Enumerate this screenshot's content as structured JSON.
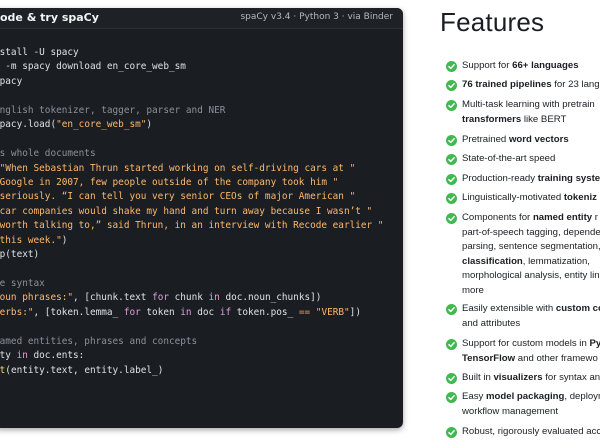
{
  "code": {
    "title": "ode & try spaCy",
    "meta": "spaCy v3.4 · Python 3 · via Binder",
    "lines": [
      [
        [
          "default",
          "nstall -U spacy"
        ]
      ],
      [
        [
          "default",
          "n -m spacy download en_core_web_sm"
        ]
      ],
      [
        [
          "default",
          "spacy"
        ]
      ],
      [
        [
          "default",
          ""
        ]
      ],
      [
        [
          "comment",
          "English tokenizer, tagger, parser and NER"
        ]
      ],
      [
        [
          "default",
          "spacy.load("
        ],
        [
          "string",
          "\"en_core_web_sm\""
        ],
        [
          "default",
          ")"
        ]
      ],
      [
        [
          "default",
          ""
        ]
      ],
      [
        [
          "comment",
          "ss whole documents"
        ]
      ],
      [
        [
          "default",
          "("
        ],
        [
          "string",
          "\"When Sebastian Thrun started working on self-driving cars at \""
        ]
      ],
      [
        [
          "string",
          "\"Google in 2007, few people outside of the company took him \""
        ]
      ],
      [
        [
          "string",
          "\"seriously. “I can tell you very senior CEOs of major American \""
        ]
      ],
      [
        [
          "string",
          "\"car companies would shake my hand and turn away because I wasn’t \""
        ]
      ],
      [
        [
          "string",
          "\"worth talking to,” said Thrun, in an interview with Recode earlier \""
        ]
      ],
      [
        [
          "string",
          "\"this week.\""
        ],
        [
          "default",
          ")"
        ]
      ],
      [
        [
          "default",
          "lp(text)"
        ]
      ],
      [
        [
          "default",
          ""
        ]
      ],
      [
        [
          "comment",
          "ze syntax"
        ]
      ],
      [
        [
          "string",
          "Noun phrases:\""
        ],
        [
          "default",
          ", [chunk.text "
        ],
        [
          "keyword",
          "for"
        ],
        [
          "default",
          " chunk "
        ],
        [
          "keyword",
          "in"
        ],
        [
          "default",
          " doc.noun_chunks])"
        ]
      ],
      [
        [
          "string",
          "Verbs:\""
        ],
        [
          "default",
          ", [token.lemma_ "
        ],
        [
          "keyword",
          "for"
        ],
        [
          "default",
          " token "
        ],
        [
          "keyword",
          "in"
        ],
        [
          "default",
          " doc "
        ],
        [
          "keyword",
          "if"
        ],
        [
          "default",
          " token.pos_ "
        ],
        [
          "op",
          "=="
        ],
        [
          "default",
          " "
        ],
        [
          "string",
          "\"VERB\""
        ],
        [
          "default",
          "])"
        ]
      ],
      [
        [
          "default",
          ""
        ]
      ],
      [
        [
          "comment",
          "named entities, phrases and concepts"
        ]
      ],
      [
        [
          "default",
          "ity "
        ],
        [
          "keyword",
          "in"
        ],
        [
          "default",
          " doc.ents:"
        ]
      ],
      [
        [
          "func",
          "nt"
        ],
        [
          "default",
          "(entity.text, entity.label_)"
        ]
      ]
    ]
  },
  "features": {
    "title": "Features",
    "items": [
      {
        "segments": [
          [
            "Support for "
          ],
          [
            "66+ languages",
            "b"
          ]
        ]
      },
      {
        "segments": [
          [
            "76 trained pipelines",
            "b"
          ],
          [
            " for 23 lang"
          ]
        ]
      },
      {
        "segments": [
          [
            "Multi-task learning with pretrain\n"
          ],
          [
            "transformers",
            "b"
          ],
          [
            " like BERT"
          ]
        ]
      },
      {
        "segments": [
          [
            "Pretrained "
          ],
          [
            "word vectors",
            "b"
          ]
        ]
      },
      {
        "segments": [
          [
            "State-of-the-art speed"
          ]
        ]
      },
      {
        "segments": [
          [
            "Production-ready "
          ],
          [
            "training syste",
            "b"
          ]
        ]
      },
      {
        "segments": [
          [
            "Linguistically-motivated "
          ],
          [
            "tokeniz",
            "b"
          ]
        ]
      },
      {
        "segments": [
          [
            "Components for "
          ],
          [
            "named entity",
            "b"
          ],
          [
            " r\npart-of-speech tagging, depende\nparsing, sentence segmentation,\n"
          ],
          [
            "classification",
            "b"
          ],
          [
            ", lemmatization,\nmorphological analysis, entity lin\nmore"
          ]
        ]
      },
      {
        "segments": [
          [
            "Easily extensible with "
          ],
          [
            "custom co",
            "b"
          ],
          [
            "\nand attributes"
          ]
        ]
      },
      {
        "segments": [
          [
            "Support for custom models in "
          ],
          [
            "Py",
            "b"
          ],
          [
            "\n"
          ],
          [
            "TensorFlow",
            "b"
          ],
          [
            " and other framewo"
          ]
        ]
      },
      {
        "segments": [
          [
            "Built in "
          ],
          [
            "visualizers",
            "b"
          ],
          [
            " for syntax and"
          ]
        ]
      },
      {
        "segments": [
          [
            "Easy "
          ],
          [
            "model packaging",
            "b"
          ],
          [
            ", deploym\nworkflow management"
          ]
        ]
      },
      {
        "segments": [
          [
            "Robust, rigorously evaluated acc"
          ]
        ]
      }
    ]
  },
  "colors": {
    "code_bg": "#1a1e23",
    "check": "#3fb950",
    "text": "#1a1e23",
    "string": "#ffb86b",
    "keyword": "#e29bdf",
    "comment": "#8b9198"
  },
  "icons": {
    "feature_bullet": "check-circle-icon"
  }
}
